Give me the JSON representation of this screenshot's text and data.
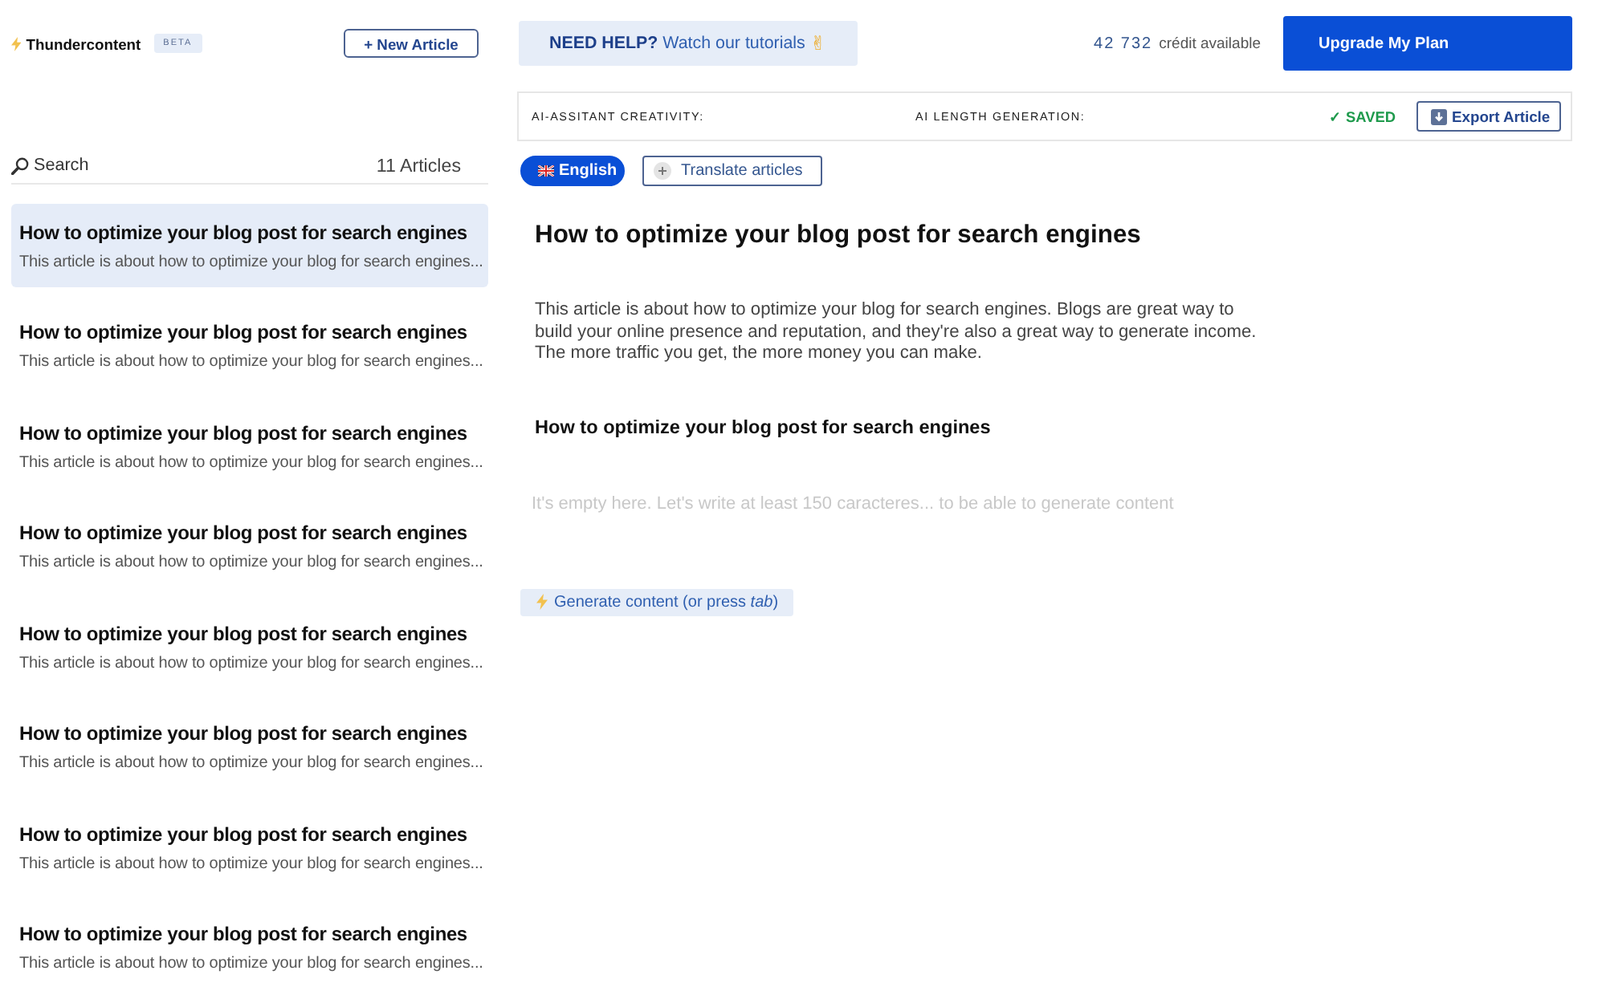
{
  "brand": {
    "name": "Thundercontent",
    "badge": "BETA"
  },
  "new_article_button": "+ New Article",
  "search": {
    "placeholder": "Search"
  },
  "article_count": "11 Articles",
  "articles": [
    {
      "title": "How to optimize your blog post for search engines",
      "excerpt": "This article is about how to optimize your blog for search engines...",
      "selected": true
    },
    {
      "title": "How to optimize your blog post for search engines",
      "excerpt": "This article is about how to optimize your blog for search engines...",
      "selected": false
    },
    {
      "title": "How to optimize your blog post for search engines",
      "excerpt": "This article is about how to optimize your blog for search engines...",
      "selected": false
    },
    {
      "title": "How to optimize your blog post for search engines",
      "excerpt": "This article is about how to optimize your blog for search engines...",
      "selected": false
    },
    {
      "title": "How to optimize your blog post for search engines",
      "excerpt": "This article is about how to optimize your blog for search engines...",
      "selected": false
    },
    {
      "title": "How to optimize your blog post for search engines",
      "excerpt": "This article is about how to optimize your blog for search engines...",
      "selected": false
    },
    {
      "title": "How to optimize your blog post for search engines",
      "excerpt": "This article is about how to optimize your blog for search engines...",
      "selected": false
    },
    {
      "title": "How to optimize your blog post for search engines",
      "excerpt": "This article is about how to optimize your blog for search engines...",
      "selected": false
    }
  ],
  "help_banner": {
    "label": "**NEED HELP?** Watch our tutorials",
    "emoji": "✌"
  },
  "credits": {
    "amount": "42 732",
    "label": "crédit available"
  },
  "upgrade_button": "Upgrade My Plan",
  "settings": [
    {
      "label": "AI-ASSITANT CREATIVITY:"
    },
    {
      "label": "AI LENGTH GENERATION:"
    }
  ],
  "save_status": "✓ SAVED",
  "export_button": "Export Article",
  "language": {
    "label": "English",
    "selected": true
  },
  "translate_button": "Translate articles",
  "editor": {
    "title": "How to optimize your blog post for search engines",
    "intro": "This article is about how to optimize your blog for search engines. Blogs are great way to build your online presence and reputation, and they're also a great way to generate income. The more traffic you get, the more money you can make.",
    "subheading": "How to optimize your blog post for search engines",
    "placeholder": "It's empty here. Let's write at least 150 caracteres... to be able to generate content",
    "generate_button": "Generate content (or press *tab*)"
  }
}
